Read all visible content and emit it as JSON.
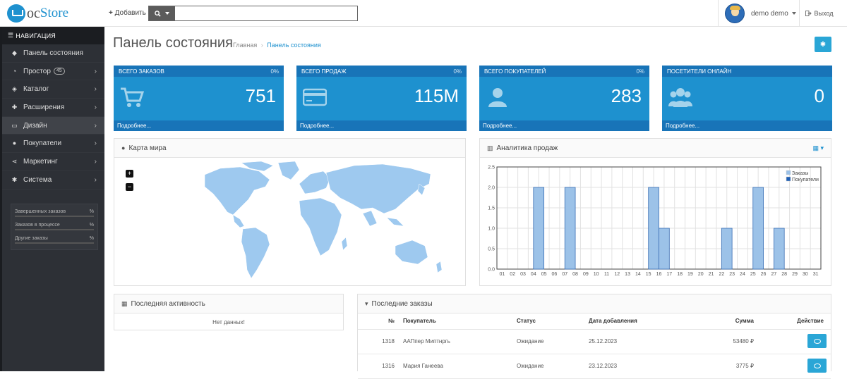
{
  "header": {
    "logo_oc": "oc",
    "logo_store": "Store",
    "add_label": "Добавить",
    "search_placeholder": "",
    "user_name": "demo demo",
    "logout_label": "Выход"
  },
  "sidebar": {
    "nav_header": "НАВИГАЦИЯ",
    "items": [
      {
        "label": "Панель состояния",
        "icon": "dashboard-icon"
      },
      {
        "label": "Простор",
        "badge": "45",
        "icon": "speedometer-icon"
      },
      {
        "label": "Каталог",
        "icon": "tags-icon"
      },
      {
        "label": "Расширения",
        "icon": "puzzle-icon"
      },
      {
        "label": "Дизайн",
        "icon": "monitor-icon"
      },
      {
        "label": "Покупатели",
        "icon": "user-icon"
      },
      {
        "label": "Маркетинг",
        "icon": "share-icon"
      },
      {
        "label": "Система",
        "icon": "gear-icon"
      }
    ],
    "stats": [
      {
        "label": "Завершенных заказов",
        "value": "%"
      },
      {
        "label": "Заказов в процессе",
        "value": "%"
      },
      {
        "label": "Другие заказы",
        "value": "%"
      }
    ]
  },
  "page": {
    "title": "Панель состояния",
    "breadcrumb": [
      "Главная",
      "Панель состояния"
    ]
  },
  "tiles": [
    {
      "title": "ВСЕГО ЗАКАЗОВ",
      "percent": "0%",
      "value": "751",
      "footer": "Подробнее...",
      "icon": "cart-icon"
    },
    {
      "title": "ВСЕГО ПРОДАЖ",
      "percent": "0%",
      "value": "115M",
      "footer": "Подробнее...",
      "icon": "credit-card-icon"
    },
    {
      "title": "ВСЕГО ПОКУПАТЕЛЕЙ",
      "percent": "0%",
      "value": "283",
      "footer": "Подробнее...",
      "icon": "user-icon"
    },
    {
      "title": "ПОСЕТИТЕЛИ ОНЛАЙН",
      "percent": "",
      "value": "0",
      "footer": "Подробнее...",
      "icon": "users-icon"
    }
  ],
  "map_panel": {
    "title": "Карта мира",
    "zoom_in": "+",
    "zoom_out": "−"
  },
  "sales_panel": {
    "title": "Аналитика продаж"
  },
  "activity_panel": {
    "title": "Последняя активность",
    "empty": "Нет данных!"
  },
  "orders_panel": {
    "title": "Последние заказы",
    "columns": [
      "№",
      "Покупатель",
      "Статус",
      "Дата добавления",
      "Сумма",
      "Действие"
    ],
    "rows": [
      {
        "id": "1318",
        "customer": "ААПпер Миптнргь",
        "status": "Ожидание",
        "date": "25.12.2023",
        "total": "53480 ₽"
      },
      {
        "id": "1316",
        "customer": "Мария Ганеева",
        "status": "Ожидание",
        "date": "23.12.2023",
        "total": "3775 ₽"
      }
    ]
  },
  "chart_data": {
    "type": "bar",
    "categories": [
      "01",
      "02",
      "03",
      "04",
      "05",
      "06",
      "07",
      "08",
      "09",
      "10",
      "11",
      "12",
      "13",
      "14",
      "15",
      "16",
      "17",
      "18",
      "19",
      "20",
      "21",
      "22",
      "23",
      "24",
      "25",
      "26",
      "27",
      "28",
      "29",
      "30",
      "31"
    ],
    "series": [
      {
        "name": "Заказы",
        "color": "#9cc2e8",
        "values": [
          0,
          0,
          0,
          2,
          0,
          0,
          2,
          0,
          0,
          0,
          0,
          0,
          0,
          0,
          2,
          1,
          0,
          0,
          0,
          0,
          0,
          1,
          0,
          0,
          2,
          0,
          1,
          0,
          0,
          0,
          0
        ]
      },
      {
        "name": "Покупатели",
        "color": "#1e5fb5",
        "values": [
          0,
          0,
          0,
          0,
          0,
          0,
          0,
          0,
          0,
          0,
          0,
          0,
          0,
          0,
          0,
          0,
          0,
          0,
          0,
          0,
          0,
          0,
          0,
          0,
          0,
          0,
          0,
          0,
          0,
          0,
          0
        ]
      }
    ],
    "yticks": [
      "0.0",
      "0.5",
      "1.0",
      "1.5",
      "2.0",
      "2.5"
    ],
    "ylim": [
      0,
      2.5
    ],
    "grid": true,
    "legend": "top-right"
  },
  "colors": {
    "accent": "#1e91cf",
    "tile_dark": "#1874b8",
    "sidebar": "#2d3036"
  }
}
